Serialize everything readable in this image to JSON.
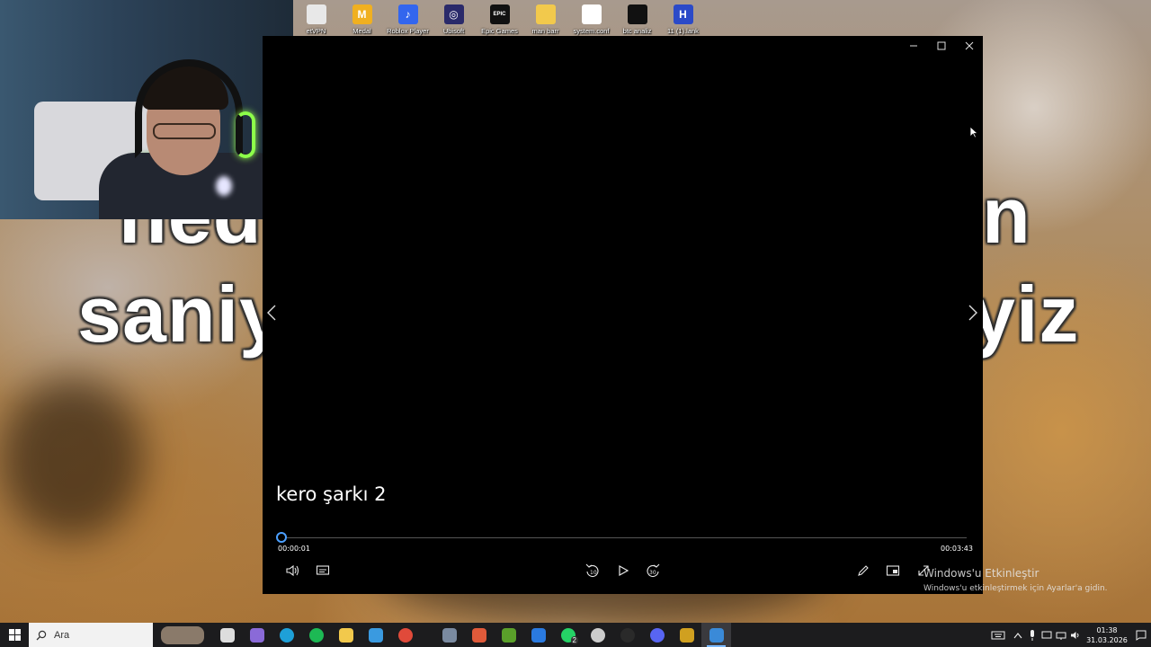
{
  "desktop": {
    "wallpaper_text": [
      "ned",
      "n",
      "saniy",
      "yiz"
    ],
    "icons": [
      {
        "label": "etVPN",
        "icon": "file-icon",
        "color": "#e8e8e8",
        "glyph": ""
      },
      {
        "label": "Medal",
        "icon": "medal-icon",
        "color": "#f0b020",
        "glyph": "M"
      },
      {
        "label": "Roblox Player",
        "icon": "roblox-icon",
        "color": "#3366ee",
        "glyph": "♪"
      },
      {
        "label": "Ubisoft",
        "icon": "ubisoft-icon",
        "color": "#2a2a6a",
        "glyph": "◎"
      },
      {
        "label": "Epic Games",
        "icon": "epic-games-icon",
        "color": "#111111",
        "glyph": "EPIC"
      },
      {
        "label": "man barr",
        "icon": "folder-icon",
        "color": "#f2c94c",
        "glyph": ""
      },
      {
        "label": "system.conf",
        "icon": "file-icon",
        "color": "#ffffff",
        "glyph": ""
      },
      {
        "label": "btc analiz",
        "icon": "document-icon",
        "color": "#111111",
        "glyph": ""
      },
      {
        "label": "11 (1).lank",
        "icon": "h-app-icon",
        "color": "#2b4ac8",
        "glyph": "H"
      }
    ]
  },
  "player": {
    "video_title": "kero şarkı 2",
    "current_time": "00:00:01",
    "total_time": "00:03:43",
    "progress": 0.005,
    "accent": "#4ca0ff"
  },
  "activation": {
    "title": "Windows'u Etkinleştir",
    "subtitle": "Windows'u etkinleştirmek için Ayarlar'a gidin."
  },
  "taskbar": {
    "search_placeholder": "Ara",
    "apps": [
      {
        "name": "taskbar-widget",
        "color": "#8a7a6a"
      },
      {
        "name": "task-view",
        "color": "#dddddd"
      },
      {
        "name": "copilot",
        "color": "#8a6ad8"
      },
      {
        "name": "edge",
        "color": "#1ea0d8"
      },
      {
        "name": "spotify",
        "color": "#1db954"
      },
      {
        "name": "file-explorer",
        "color": "#f2c94c"
      },
      {
        "name": "store",
        "color": "#3a9ae0"
      },
      {
        "name": "chrome",
        "color": "#e04a3a"
      },
      {
        "name": "app-1",
        "color": "#7a8aa0"
      },
      {
        "name": "app-2",
        "color": "#e05a3a"
      },
      {
        "name": "minecraft",
        "color": "#5aa02a"
      },
      {
        "name": "mail",
        "color": "#2a7ae0"
      },
      {
        "name": "whatsapp",
        "color": "#25d366"
      },
      {
        "name": "unity",
        "color": "#cccccc"
      },
      {
        "name": "media-app",
        "color": "#2a2a2a"
      },
      {
        "name": "discord",
        "color": "#5865f2"
      },
      {
        "name": "app-3",
        "color": "#d0a020"
      },
      {
        "name": "media-player",
        "color": "#3a8ad8"
      }
    ],
    "whatsapp_badge": "2",
    "clock_time": "01:38",
    "clock_date": "31.03.2026"
  }
}
